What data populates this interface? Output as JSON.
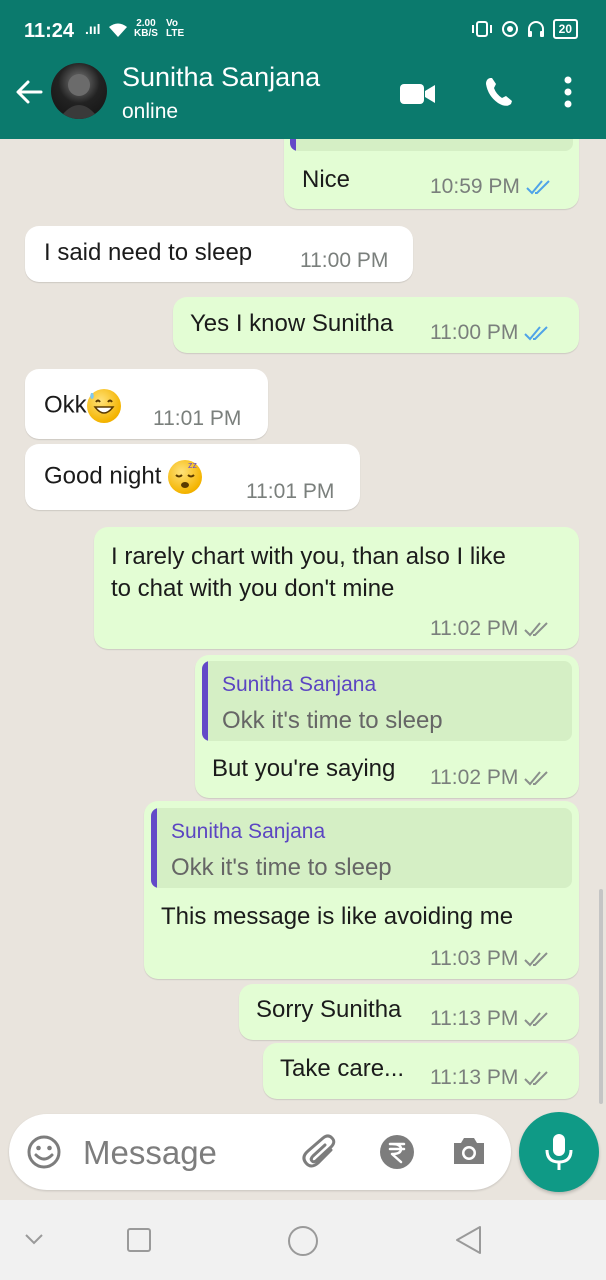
{
  "status_bar": {
    "time": "11:24",
    "signal": ".ııl",
    "speed_value": "2.00",
    "speed_unit": "KB/S",
    "carrier_top": "Vo",
    "carrier_bottom": "LTE",
    "battery": "20"
  },
  "header": {
    "contact_name": "Sunitha Sanjana",
    "contact_status": "online",
    "icons": [
      "back-arrow-icon",
      "video-call-icon",
      "phone-icon",
      "more-options-icon"
    ]
  },
  "messages": [
    {
      "id": "m1",
      "direction": "out",
      "text": "Nice",
      "time": "10:59 PM",
      "ticks": "read"
    },
    {
      "id": "m2",
      "direction": "in",
      "text": "I said need to sleep",
      "time": "11:00 PM"
    },
    {
      "id": "m3",
      "direction": "out",
      "text": "Yes I know Sunitha",
      "time": "11:00 PM",
      "ticks": "read"
    },
    {
      "id": "m4",
      "direction": "in",
      "text": "Okk",
      "emoji": "grinning-sweat",
      "time": "11:01 PM"
    },
    {
      "id": "m5",
      "direction": "in",
      "text": "Good night ",
      "emoji": "sleeping-face",
      "time": "11:01 PM"
    },
    {
      "id": "m6",
      "direction": "out",
      "line1": "I rarely chart with you, than also I like",
      "line2": "to chat with you don't mine",
      "time": "11:02 PM",
      "ticks": "delivered"
    },
    {
      "id": "m7",
      "direction": "out",
      "reply_name": "Sunitha Sanjana",
      "reply_text": "Okk it's time to sleep",
      "text": "But you're saying",
      "time": "11:02 PM",
      "ticks": "delivered"
    },
    {
      "id": "m8",
      "direction": "out",
      "reply_name": "Sunitha Sanjana",
      "reply_text": "Okk it's time to sleep",
      "text": "This message is like avoiding me",
      "time": "11:03 PM",
      "ticks": "delivered"
    },
    {
      "id": "m9",
      "direction": "out",
      "text": "Sorry Sunitha",
      "time": "11:13 PM",
      "ticks": "delivered"
    },
    {
      "id": "m10",
      "direction": "out",
      "text": "Take care...",
      "time": "11:13 PM",
      "ticks": "delivered"
    }
  ],
  "composer": {
    "placeholder": "Message",
    "icons": [
      "emoji-icon",
      "attach-icon",
      "rupee-payment-icon",
      "camera-icon",
      "mic-icon"
    ]
  },
  "colors": {
    "header": "#0b7a6d",
    "outgoing_bubble": "#e3fdd4",
    "incoming_bubble": "#ffffff",
    "read_tick": "#4fa3e8",
    "reply_accent": "#6349c8",
    "mic_button": "#0f9a86"
  }
}
